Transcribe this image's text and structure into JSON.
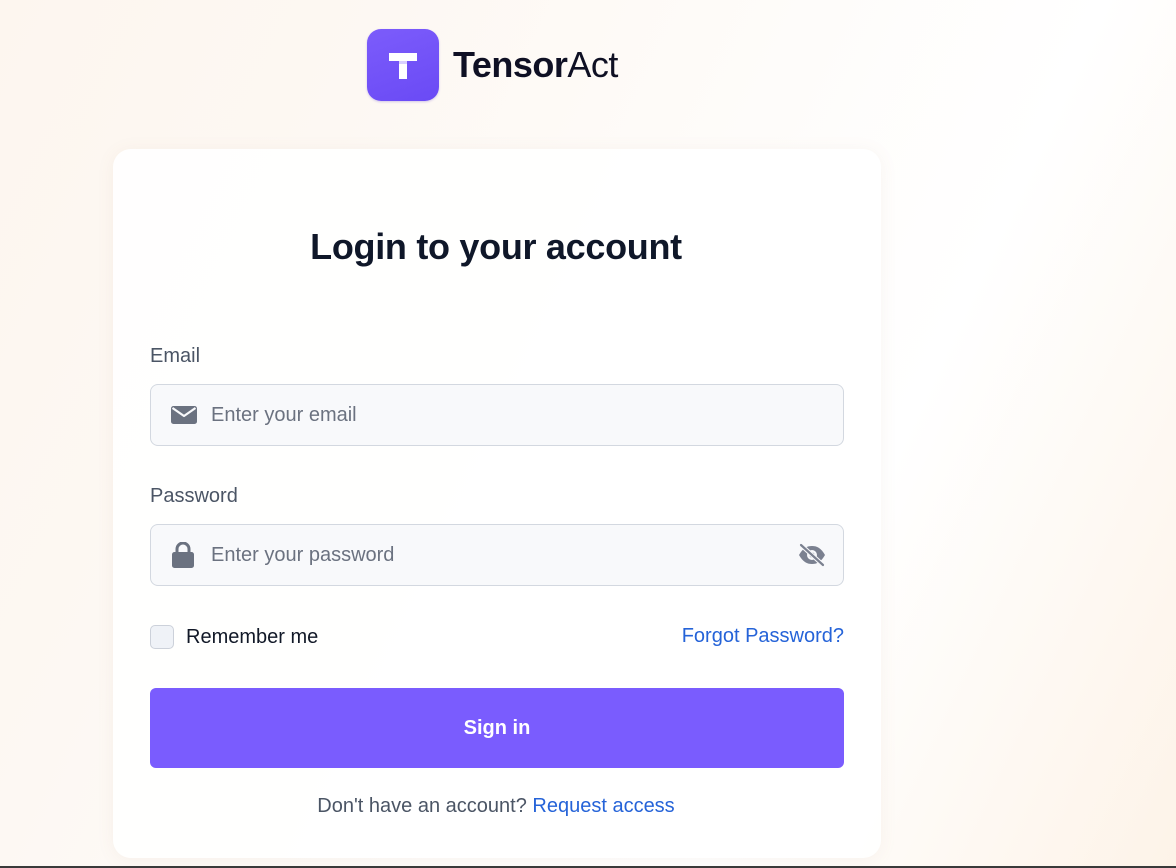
{
  "brand": {
    "name_strong": "Tensor",
    "name_light": "Act",
    "logo_letter": "T",
    "accent_color": "#7a5cfe"
  },
  "login": {
    "title": "Login to your account",
    "email": {
      "label": "Email",
      "placeholder": "Enter your email",
      "value": "",
      "icon": "envelope-icon"
    },
    "password": {
      "label": "Password",
      "placeholder": "Enter your password",
      "value": "",
      "icon": "lock-icon",
      "toggle_icon": "eye-off-icon"
    },
    "remember_label": "Remember me",
    "remember_checked": false,
    "forgot_label": "Forgot Password?",
    "submit_label": "Sign in",
    "footer_text": "Don't have an account?",
    "footer_link": "Request access"
  }
}
